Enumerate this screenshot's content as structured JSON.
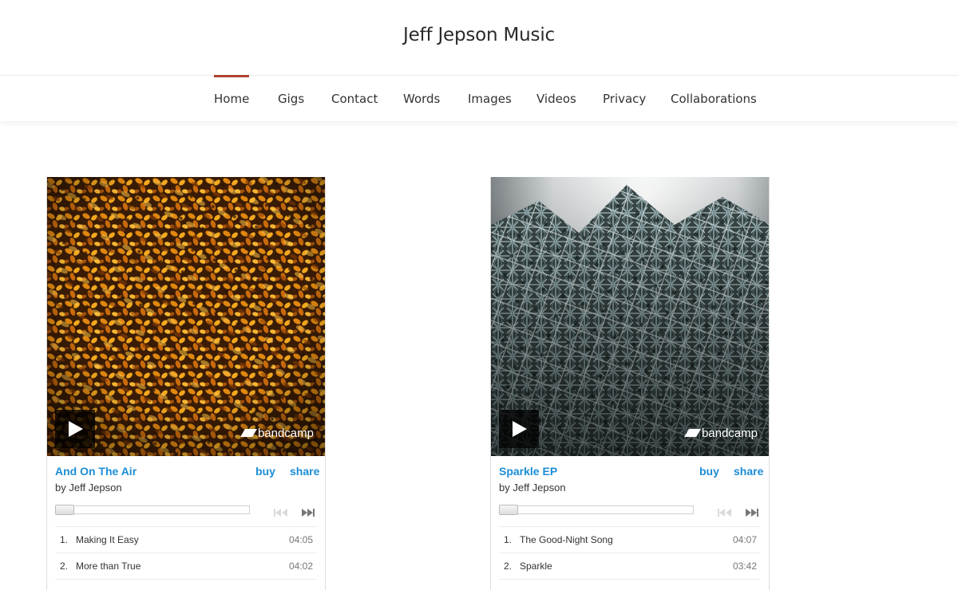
{
  "site": {
    "title": "Jeff Jepson Music"
  },
  "nav": {
    "items": [
      {
        "label": "Home",
        "active": true
      },
      {
        "label": "Gigs",
        "active": false
      },
      {
        "label": "Contact",
        "active": false
      },
      {
        "label": "Words",
        "active": false
      },
      {
        "label": "Images",
        "active": false
      },
      {
        "label": "Videos",
        "active": false
      },
      {
        "label": "Privacy",
        "active": false
      },
      {
        "label": "Collaborations",
        "active": false
      }
    ]
  },
  "colors": {
    "accent_red": "#b0432f",
    "link_blue": "#1d8dd6"
  },
  "players": [
    {
      "artwork": "orange-gorse-flowers",
      "brand": "bandcamp",
      "title": "And On The Air",
      "artist": "by Jeff Jepson",
      "buy_label": "buy",
      "share_label": "share",
      "tracks": [
        {
          "num": "1.",
          "name": "Making It Easy",
          "duration": "04:05"
        },
        {
          "num": "2.",
          "name": "More than True",
          "duration": "04:02"
        }
      ]
    },
    {
      "artwork": "frosted-fir-tree",
      "brand": "bandcamp",
      "title": "Sparkle EP",
      "artist": "by Jeff Jepson",
      "buy_label": "buy",
      "share_label": "share",
      "tracks": [
        {
          "num": "1.",
          "name": "The Good-Night Song",
          "duration": "04:07"
        },
        {
          "num": "2.",
          "name": "Sparkle",
          "duration": "03:42"
        }
      ]
    }
  ]
}
